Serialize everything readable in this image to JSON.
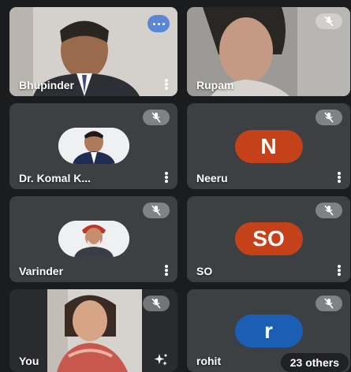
{
  "participants": [
    {
      "name": "Bhupinder",
      "video": "camera",
      "speaking": true
    },
    {
      "name": "Rupam",
      "video": "camera",
      "muted": true
    },
    {
      "name": "Dr. Komal K...",
      "video": "avatar-photo",
      "muted": true
    },
    {
      "name": "Neeru",
      "video": "letter",
      "initials": "N",
      "color": "#c5411a",
      "muted": true
    },
    {
      "name": "Varinder",
      "video": "avatar-photo",
      "muted": true
    },
    {
      "name": "SO",
      "video": "letter",
      "initials": "SO",
      "color": "#c5411a",
      "muted": true
    },
    {
      "name": "You",
      "video": "camera",
      "muted": true
    },
    {
      "name": "rohit",
      "video": "letter",
      "initials": "r",
      "color": "#1b5eb4",
      "muted": true
    }
  ],
  "others_label": "23 others",
  "icons": [
    "speaking-indicator-icon",
    "mic-off-icon",
    "more-options-icon",
    "visual-effects-icon"
  ]
}
